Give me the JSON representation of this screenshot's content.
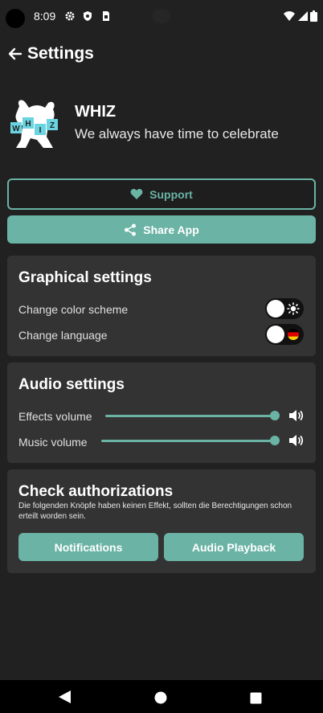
{
  "status_bar": {
    "time": "8:09",
    "icons": [
      "gear-icon",
      "shield-icon",
      "sim-card-icon",
      "wifi-icon",
      "signal-icon",
      "battery-icon"
    ]
  },
  "app_bar": {
    "title": "Settings",
    "back_icon": "arrow-left-icon"
  },
  "hero": {
    "app_name": "WHIZ",
    "tagline": "We always have time to celebrate",
    "logo_letters": [
      "W",
      "H",
      "I",
      "Z"
    ]
  },
  "actions": {
    "support_label": "Support",
    "support_icon": "heart-icon",
    "share_label": "Share App",
    "share_icon": "share-icon"
  },
  "graphical_settings": {
    "title": "Graphical settings",
    "rows": [
      {
        "label": "Change color scheme",
        "icon": "sun-icon",
        "state": "off"
      },
      {
        "label": "Change language",
        "icon": "german-flag-icon",
        "state": "off"
      }
    ]
  },
  "audio_settings": {
    "title": "Audio settings",
    "rows": [
      {
        "label": "Effects volume",
        "level": 1.0,
        "icon": "speaker-icon"
      },
      {
        "label": "Music volume",
        "level": 1.0,
        "icon": "speaker-icon"
      }
    ]
  },
  "authorizations": {
    "title": "Check authorizations",
    "note": "Die folgenden Knöpfe haben keinen Effekt, sollten die Berechtigungen schon erteilt worden sein.",
    "buttons": [
      "Notifications",
      "Audio Playback"
    ]
  },
  "nav_bar": {
    "buttons": [
      "back-triangle-icon",
      "home-circle-icon",
      "recents-square-icon"
    ]
  },
  "colors": {
    "background": "#212121",
    "card": "#333333",
    "accent": "#6ab3a5",
    "text": "#ffffff"
  }
}
